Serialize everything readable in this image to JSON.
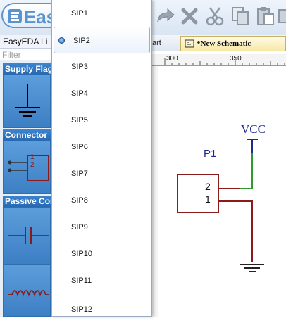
{
  "app": {
    "logo_text": "Easy",
    "library_title": "EasyEDA Li",
    "filter_placeholder": "Filter"
  },
  "library": {
    "sections": [
      {
        "label": "Supply Flag"
      },
      {
        "label": "Connector"
      },
      {
        "label": "Passive Con"
      }
    ],
    "connector_pins": [
      "1",
      "2"
    ]
  },
  "tabs": {
    "start_label": "art",
    "new_schematic_label": "*New Schematic"
  },
  "ruler": {
    "ticks": [
      "300",
      "350"
    ]
  },
  "dropdown": {
    "items": [
      "SIP1",
      "SIP2",
      "SIP3",
      "SIP4",
      "SIP5",
      "SIP6",
      "SIP7",
      "SIP8",
      "SIP9",
      "SIP10",
      "SIP11",
      "SIP12"
    ],
    "selected_index": 1
  },
  "schematic": {
    "power_label": "VCC",
    "part_designator": "P1",
    "pin_numbers": [
      "2",
      "1"
    ]
  },
  "colors": {
    "accent_blue": "#2f78c4",
    "wire_green": "#2e9a2e",
    "wire_red": "#8b1a1a",
    "power_blue": "#1f2a8f"
  }
}
